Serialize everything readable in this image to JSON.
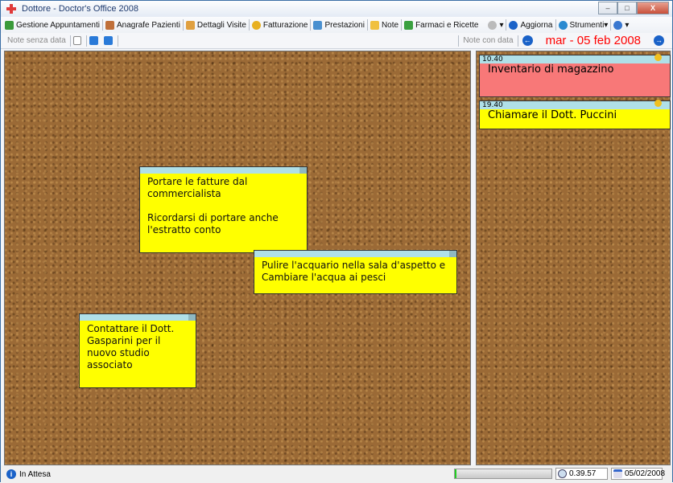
{
  "window": {
    "title": "Dottore - Doctor's Office 2008",
    "minimize": "–",
    "maximize": "□",
    "close": "X"
  },
  "toolbar": [
    {
      "label": "Gestione Appuntamenti",
      "icon": "book-icon",
      "color": "#3a9a3a"
    },
    {
      "label": "Anagrafe Pazienti",
      "icon": "users-icon",
      "color": "#c0703a"
    },
    {
      "label": "Dettagli Visite",
      "icon": "clipboard-icon",
      "color": "#e0a040"
    },
    {
      "label": "Fatturazione",
      "icon": "coin-icon",
      "color": "#e8b020"
    },
    {
      "label": "Prestazioni",
      "icon": "medical-icon",
      "color": "#4a90d0"
    },
    {
      "label": "Note",
      "icon": "note-icon",
      "color": "#f0c040"
    },
    {
      "label": "Farmaci e Ricette",
      "icon": "prescription-icon",
      "color": "#3aa040"
    },
    {
      "label": "Aggiorna",
      "icon": "refresh-icon",
      "color": "#1a62c8"
    },
    {
      "label": "Strumenti",
      "icon": "tools-icon",
      "color": "#2a8ad0"
    }
  ],
  "subbar": {
    "left_label": "Note senza data",
    "right_label": "Note con data",
    "date": "mar - 05 feb 2008",
    "prev": "←",
    "next": "→"
  },
  "board_notes": [
    {
      "text": "Portare le fatture dal\ncommercialista\n\nRicordarsi di portare anche\nl'estratto conto"
    },
    {
      "text": "Pulire l'acquario nella sala d'aspetto e\nCambiare l'acqua ai pesci"
    },
    {
      "text": "Contattare il Dott.\nGasparini per il\nnuovo studio\nassociato"
    }
  ],
  "dated_notes": [
    {
      "time": "10.40",
      "text": "Inventario di magazzino",
      "color": "#f87878"
    },
    {
      "time": "19.40",
      "text": "Chiamare il Dott. Puccini",
      "color": "#ffff00"
    }
  ],
  "status": {
    "text": "In Attesa",
    "progress": 0.02,
    "time": "0.39.57",
    "date": "05/02/2008",
    "info": "i"
  }
}
